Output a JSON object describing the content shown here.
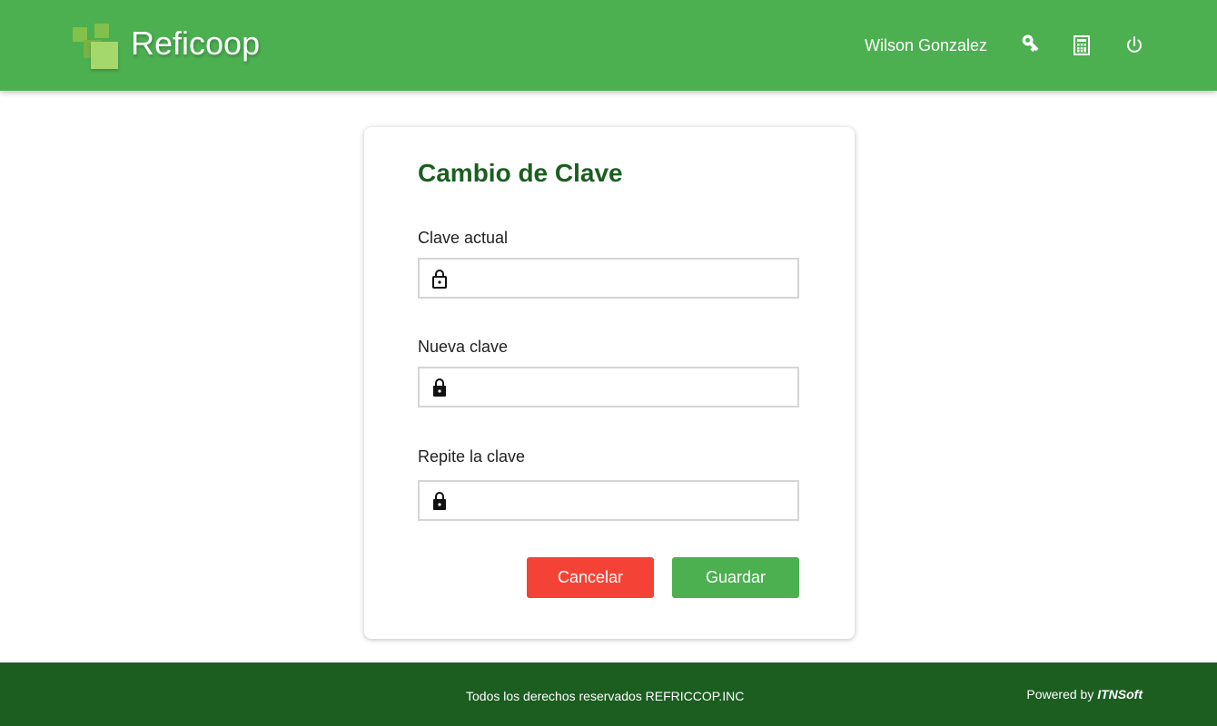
{
  "header": {
    "brand": "Reficoop",
    "user_name": "Wilson Gonzalez",
    "icons": [
      "key-icon",
      "calculator-icon",
      "power-icon"
    ],
    "color": "#4caf50"
  },
  "form": {
    "title": "Cambio de Clave",
    "fields": [
      {
        "label": "Clave actual",
        "value": "",
        "icon": "lock-open-icon"
      },
      {
        "label": "Nueva clave",
        "value": "",
        "icon": "lock-icon"
      },
      {
        "label": "Repite la clave",
        "value": "",
        "icon": "lock-icon"
      }
    ],
    "cancel_label": "Cancelar",
    "save_label": "Guardar",
    "cancel_color": "#f44336",
    "save_color": "#4caf50"
  },
  "footer": {
    "copyright": "Todos los derechos reservados REFRICCOP.INC",
    "powered_prefix": "Powered by",
    "powered_brand": "ITNSoft",
    "color": "#1b5e20"
  }
}
